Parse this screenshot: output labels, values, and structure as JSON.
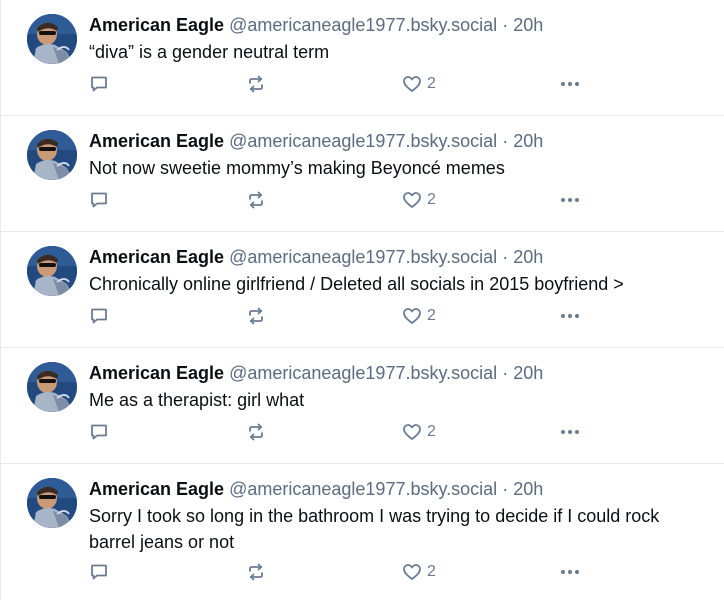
{
  "posts": [
    {
      "author": "American Eagle",
      "handle": "@americaneagle1977.bsky.social",
      "separator": "·",
      "time": "20h",
      "text": "“diva” is a gender neutral term",
      "likes": "2"
    },
    {
      "author": "American Eagle",
      "handle": "@americaneagle1977.bsky.social",
      "separator": "·",
      "time": "20h",
      "text": "Not now sweetie mommy’s making Beyoncé memes",
      "likes": "2"
    },
    {
      "author": "American Eagle",
      "handle": "@americaneagle1977.bsky.social",
      "separator": "·",
      "time": "20h",
      "text": "Chronically online girlfriend / Deleted all socials in 2015 boyfriend >",
      "likes": "2"
    },
    {
      "author": "American Eagle",
      "handle": "@americaneagle1977.bsky.social",
      "separator": "·",
      "time": "20h",
      "text": "Me as a therapist: girl what",
      "likes": "2"
    },
    {
      "author": "American Eagle",
      "handle": "@americaneagle1977.bsky.social",
      "separator": "·",
      "time": "20h",
      "text": "Sorry I took so long in the bathroom I was trying to decide if I could rock barrel jeans or not",
      "likes": "2"
    }
  ],
  "icons": {
    "avatar": "profile-photo",
    "reply": "reply-bubble-icon",
    "repost": "repost-arrows-icon",
    "like": "heart-icon",
    "more": "ellipsis-icon"
  },
  "colors": {
    "text": "#0b0f14",
    "muted": "#5b6b80",
    "icon": "#6b7c92",
    "divider": "#e6e9ee",
    "avatar_bg": "#1d3e6e"
  }
}
